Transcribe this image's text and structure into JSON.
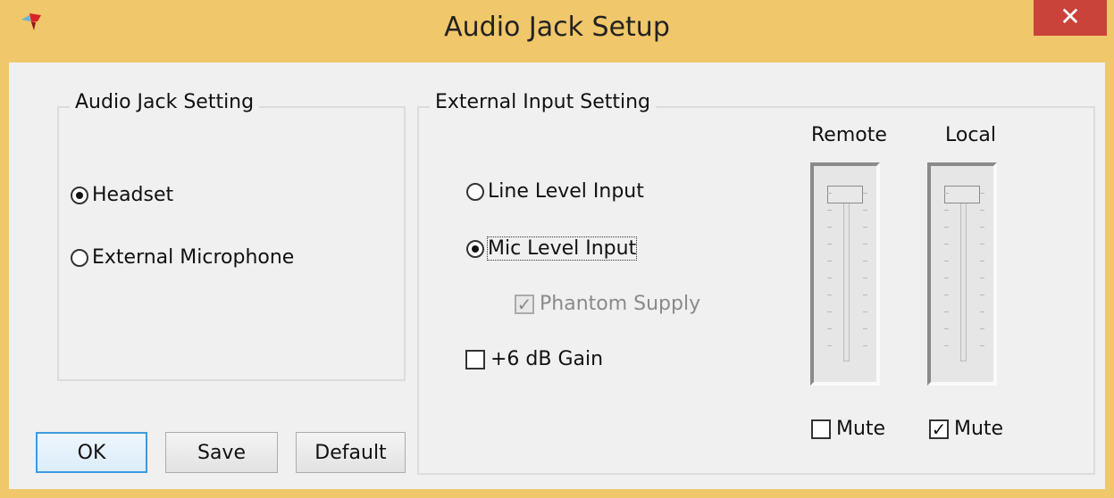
{
  "window": {
    "title": "Audio Jack Setup",
    "close_glyph": "✕"
  },
  "audio_jack_group": {
    "title": "Audio Jack Setting",
    "options": [
      {
        "label": "Headset",
        "checked": true
      },
      {
        "label": "External Microphone",
        "checked": false
      }
    ]
  },
  "external_group": {
    "title": "External Input Setting",
    "options": [
      {
        "label": "Line Level Input",
        "checked": false
      },
      {
        "label": "Mic Level Input",
        "checked": true
      }
    ],
    "phantom": {
      "label": "Phantom Supply",
      "checked": true,
      "enabled": false
    },
    "gain": {
      "label": "+6 dB Gain",
      "checked": false
    }
  },
  "sliders": [
    {
      "label": "Remote",
      "mute_label": "Mute",
      "muted": false,
      "level": 1.0
    },
    {
      "label": "Local",
      "mute_label": "Mute",
      "muted": true,
      "level": 1.0
    }
  ],
  "buttons": {
    "ok": "OK",
    "save": "Save",
    "default": "Default"
  },
  "icons": {
    "app": "app-logo-icon",
    "close": "close-icon",
    "check": "✓"
  }
}
